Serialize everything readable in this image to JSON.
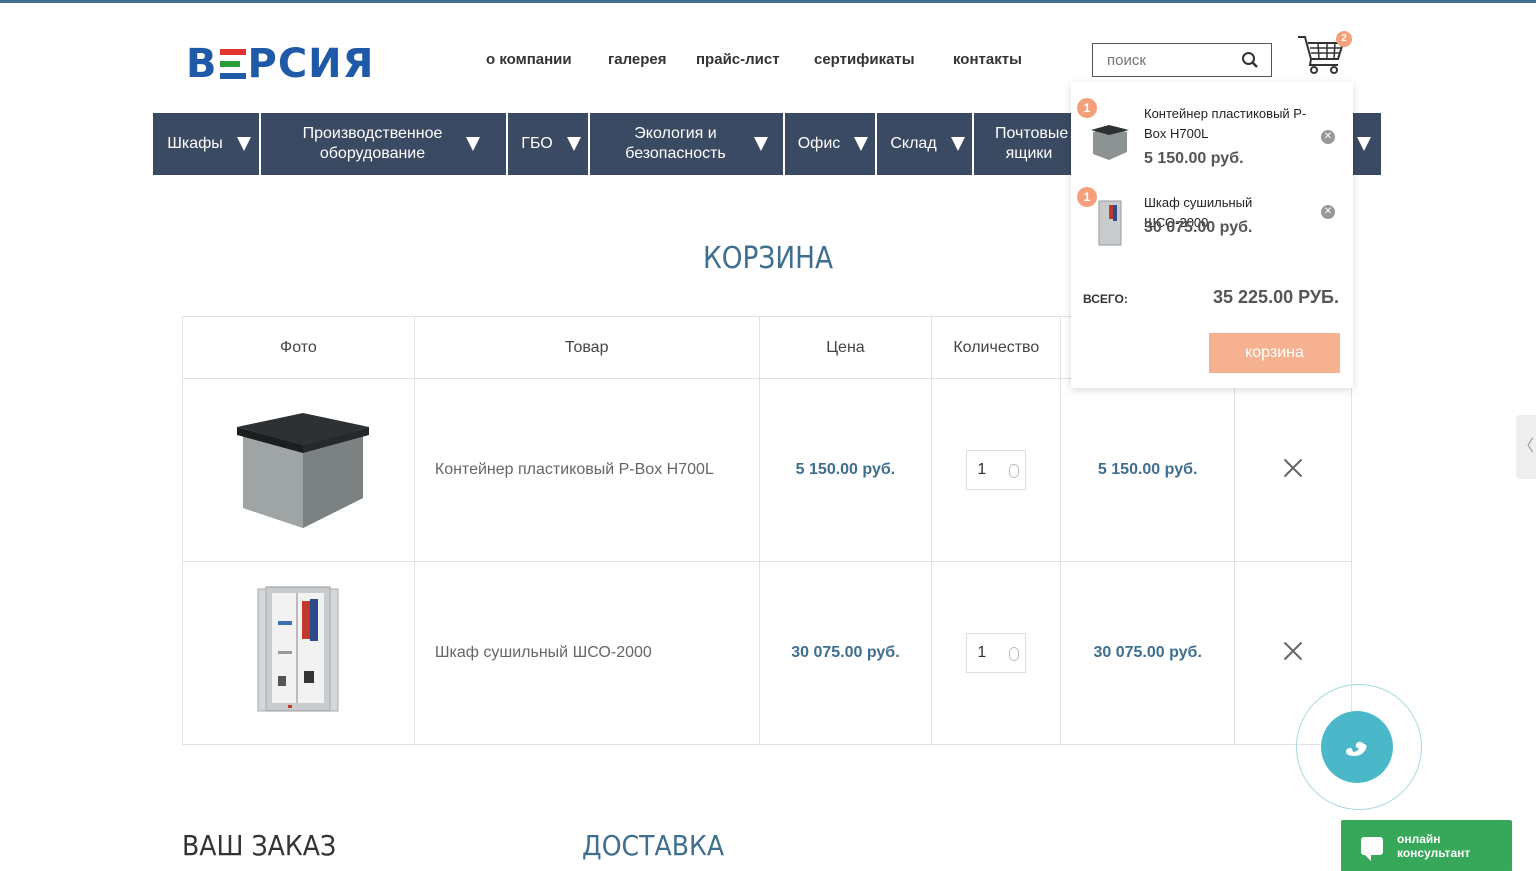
{
  "header": {
    "logo_left": "В",
    "logo_right": "РСИЯ",
    "nav": [
      "о компании",
      "галерея",
      "прайс-лист",
      "сертификаты",
      "контакты"
    ],
    "search_placeholder": "поиск",
    "cart_count": "2"
  },
  "categories": [
    {
      "label": "Шкафы"
    },
    {
      "label": "Производственное оборудование"
    },
    {
      "label": "ГБО"
    },
    {
      "label": "Экология и безопасность"
    },
    {
      "label": "Офис"
    },
    {
      "label": "Склад"
    },
    {
      "label": "Почтовые ящики"
    }
  ],
  "page_title": "КОРЗИНА",
  "table": {
    "headers": [
      "Фото",
      "Товар",
      "Цена",
      "Количество"
    ],
    "rows": [
      {
        "name": "Контейнер пластиковый P-Box H700L",
        "price": "5 150.00 руб.",
        "qty": "1",
        "sum": "5 150.00 руб."
      },
      {
        "name": "Шкаф сушильный ШСО-2000",
        "price": "30 075.00 руб.",
        "qty": "1",
        "sum": "30 075.00 руб."
      }
    ]
  },
  "mini_cart": {
    "items": [
      {
        "qty": "1",
        "name": "Контейнер пластиковый P-Box H700L",
        "price": "5 150.00 руб."
      },
      {
        "qty": "1",
        "name": "Шкаф сушильный ШСО-2000",
        "price": "30 075.00 руб."
      }
    ],
    "total_label": "ВСЕГО:",
    "total_value": "35 225.00 РУБ.",
    "button_label": "корзина"
  },
  "sections": {
    "order": "ВАШ ЗАКАЗ",
    "delivery": "ДОСТАВКА"
  },
  "consultant": {
    "label": "онлайн консультант"
  },
  "icons": [
    "search-icon",
    "cart-icon",
    "phone-icon",
    "chat-icon",
    "close-icon",
    "chevron-left-icon"
  ],
  "colors": {
    "menu_bg": "#3b4a63",
    "accent": "#3f6f8f",
    "badge": "#f4a07b",
    "cart_button": "#f6b190",
    "call": "#4bb8c9",
    "consult": "#37a85a"
  }
}
